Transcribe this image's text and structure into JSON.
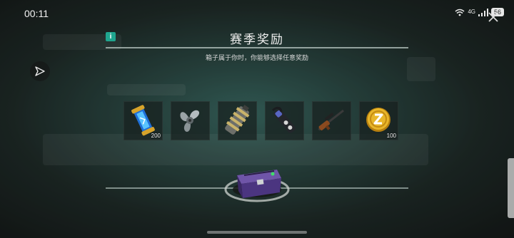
{
  "status_bar": {
    "time": "00:11",
    "network": "4G",
    "battery": "56"
  },
  "dialog": {
    "title": "赛季奖励",
    "subtitle": "箱子属于你时，你能够选择任意奖励",
    "info_symbol": "i"
  },
  "rewards": [
    {
      "icon": "energy-capsule-icon",
      "quantity": "200"
    },
    {
      "icon": "propeller-icon",
      "quantity": ""
    },
    {
      "icon": "engine-part-icon",
      "quantity": ""
    },
    {
      "icon": "scope-gear-icon",
      "quantity": ""
    },
    {
      "icon": "sniper-rifle-icon",
      "quantity": ""
    },
    {
      "icon": "gold-coin-icon",
      "quantity": "100"
    }
  ],
  "colors": {
    "accent": "#1fa58f",
    "chest": "#5b3e8a",
    "coin": "#e2a51f"
  }
}
